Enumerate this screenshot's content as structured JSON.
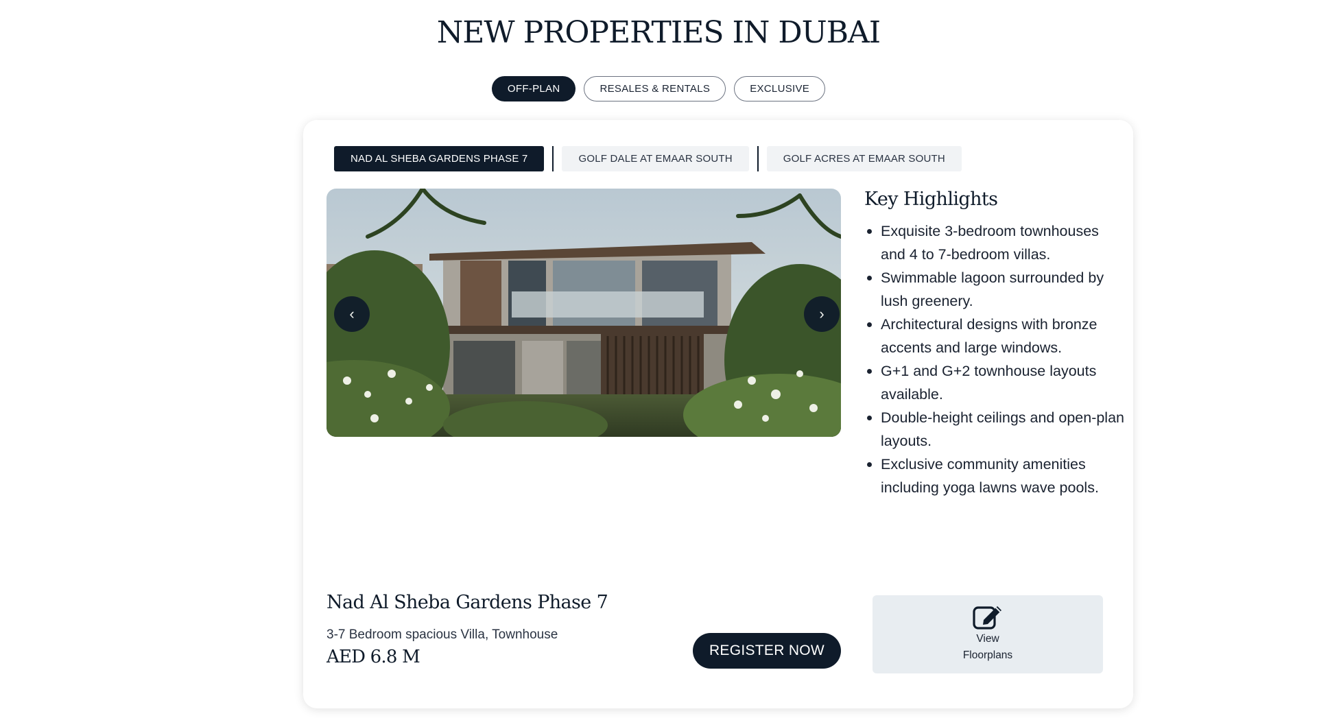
{
  "header": {
    "title": "NEW PROPERTIES IN DUBAI"
  },
  "main_tabs": [
    {
      "label": "OFF-PLAN",
      "active": true
    },
    {
      "label": "RESALES & RENTALS",
      "active": false
    },
    {
      "label": "EXCLUSIVE",
      "active": false
    }
  ],
  "project_tabs": [
    {
      "label": "NAD AL SHEBA GARDENS PHASE 7",
      "active": true
    },
    {
      "label": "GOLF DALE AT EMAAR SOUTH",
      "active": false
    },
    {
      "label": "GOLF ACRES AT EMAAR SOUTH",
      "active": false
    }
  ],
  "carousel": {
    "prev_icon": "chevron-left-icon",
    "next_icon": "chevron-right-icon"
  },
  "highlights": {
    "title": "Key Highlights",
    "items": [
      "Exquisite 3-bedroom townhouses and 4 to 7-bedroom villas.",
      "Swimmable lagoon surrounded by lush greenery.",
      "Architectural designs with bronze accents and large windows.",
      "G+1 and G+2 townhouse layouts available.",
      "Double-height ceilings and open-plan layouts.",
      "Exclusive community amenities including yoga lawns wave pools."
    ]
  },
  "property": {
    "name": "Nad Al Sheba Gardens Phase 7",
    "description": "3-7 Bedroom spacious Villa, Townhouse",
    "price": "AED 6.8 M"
  },
  "actions": {
    "register_label": "REGISTER NOW",
    "floorplans_line1": "View",
    "floorplans_line2": "Floorplans",
    "floorplans_icon": "edit-icon"
  },
  "colors": {
    "navy": "#0f1b2a",
    "panel": "#e8edf1"
  }
}
